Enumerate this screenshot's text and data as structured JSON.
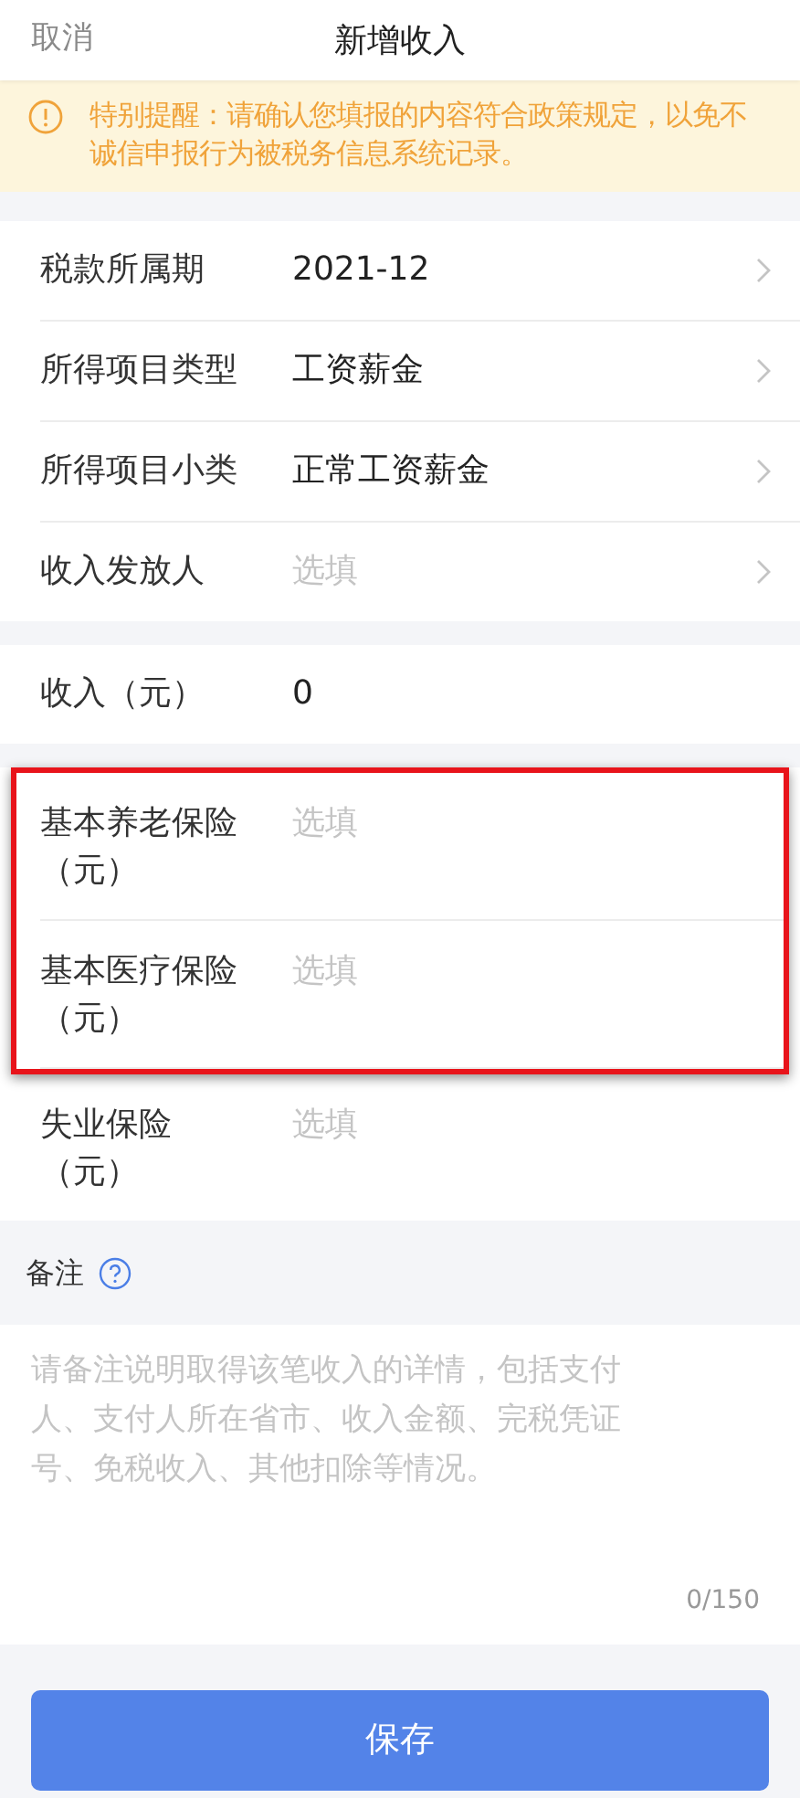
{
  "header": {
    "cancel": "取消",
    "title": "新增收入"
  },
  "notice": {
    "text": "特别提醒：请确认您填报的内容符合政策规定，以免不诚信申报行为被税务信息系统记录。"
  },
  "groups": [
    {
      "rows": [
        {
          "kind": "picker",
          "label": "税款所属期",
          "value": "2021-12",
          "highlighted": false
        },
        {
          "kind": "picker",
          "label": "所得项目类型",
          "value": "工资薪金",
          "highlighted": false
        },
        {
          "kind": "picker",
          "label": "所得项目小类",
          "value": "正常工资薪金",
          "highlighted": false
        },
        {
          "kind": "picker",
          "label": "收入发放人",
          "placeholder": "选填",
          "highlighted": false
        }
      ]
    },
    {
      "rows": [
        {
          "kind": "input",
          "label": "收入（元）",
          "value": "0",
          "highlighted": false
        }
      ]
    },
    {
      "rows": [
        {
          "kind": "input",
          "label": "基本养老保险（元）",
          "placeholder": "选填",
          "highlighted": true
        },
        {
          "kind": "input",
          "label": "基本医疗保险（元）",
          "placeholder": "选填",
          "highlighted": true
        },
        {
          "kind": "input",
          "label": "失业保险（元）",
          "placeholder": "选填",
          "highlighted": false
        }
      ]
    }
  ],
  "remarks": {
    "label": "备注",
    "placeholder": "请备注说明取得该笔收入的详情，包括支付人、支付人所在省市、收入金额、完税凭证号、免税收入、其他扣除等情况。",
    "counter": "0/150"
  },
  "save_button": "保存"
}
